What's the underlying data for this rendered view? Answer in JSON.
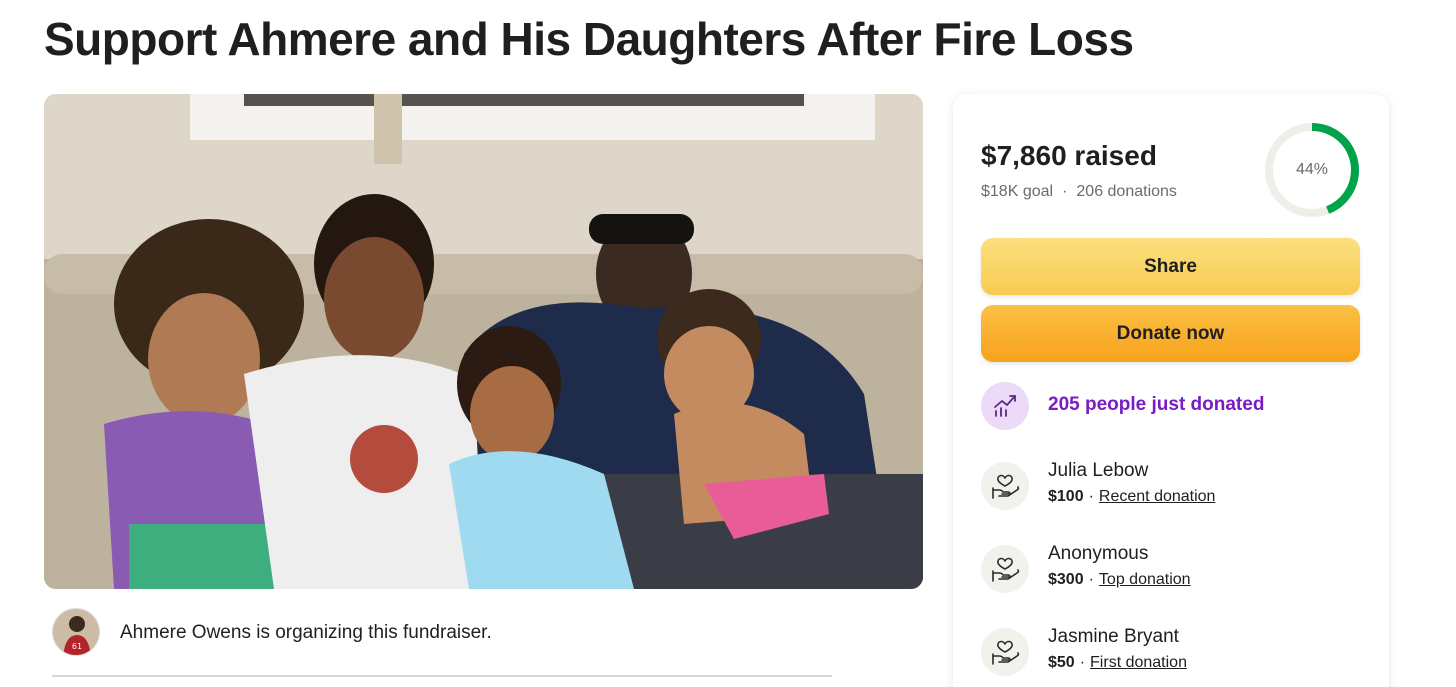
{
  "page": {
    "title": "Support Ahmere and His Daughters After Fire Loss"
  },
  "organizer": {
    "text": "Ahmere Owens is organizing this fundraiser."
  },
  "progress": {
    "raised": "$7,860 raised",
    "goal": "$18K goal",
    "separator": "·",
    "donations": "206 donations",
    "percent_label": "44%",
    "fraction": 0.44,
    "ring_color": "#00a34a",
    "track_color": "#efefea"
  },
  "buttons": {
    "share": "Share",
    "donate": "Donate now"
  },
  "trend": {
    "text": "205 people just donated",
    "color": "#7a1bc4"
  },
  "donations": [
    {
      "name": "Julia Lebow",
      "amount": "$100",
      "separator": "·",
      "tag": "Recent donation"
    },
    {
      "name": "Anonymous",
      "amount": "$300",
      "separator": "·",
      "tag": "Top donation"
    },
    {
      "name": "Jasmine Bryant",
      "amount": "$50",
      "separator": "·",
      "tag": "First donation"
    }
  ],
  "icons": {
    "trend": "trending-up-icon",
    "donation": "heart-hand-icon"
  }
}
